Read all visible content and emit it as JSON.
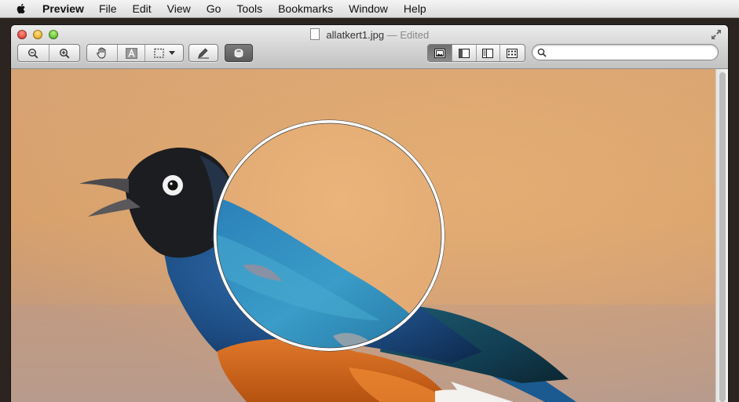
{
  "menubar": {
    "app_name": "Preview",
    "items": [
      "File",
      "Edit",
      "View",
      "Go",
      "Tools",
      "Bookmarks",
      "Window",
      "Help"
    ]
  },
  "window": {
    "filename": "allatkert1.jpg",
    "separator": "—",
    "status": "Edited"
  },
  "toolbar": {
    "zoom_out_icon": "zoom-out-icon",
    "zoom_in_icon": "zoom-in-icon",
    "move_tool_icon": "hand-icon",
    "text_tool_icon": "text-select-icon",
    "selection_tool_icon": "rect-selection-icon",
    "annotate_icon": "pencil-icon",
    "magnifier_icon": "loupe-icon",
    "view_modes": [
      "content-only-icon",
      "thumbnails-icon",
      "table-of-contents-icon",
      "contact-sheet-icon"
    ],
    "active_view": 0,
    "search_placeholder": ""
  },
  "image": {
    "subject": "bird-photo",
    "magnifier_loupe": "circular-loupe"
  },
  "colors": {
    "background_warm": "#d9a370",
    "bird_blue": "#1f4f86",
    "bird_orange": "#d86a1e",
    "magnifier_border": "#ffffff"
  }
}
